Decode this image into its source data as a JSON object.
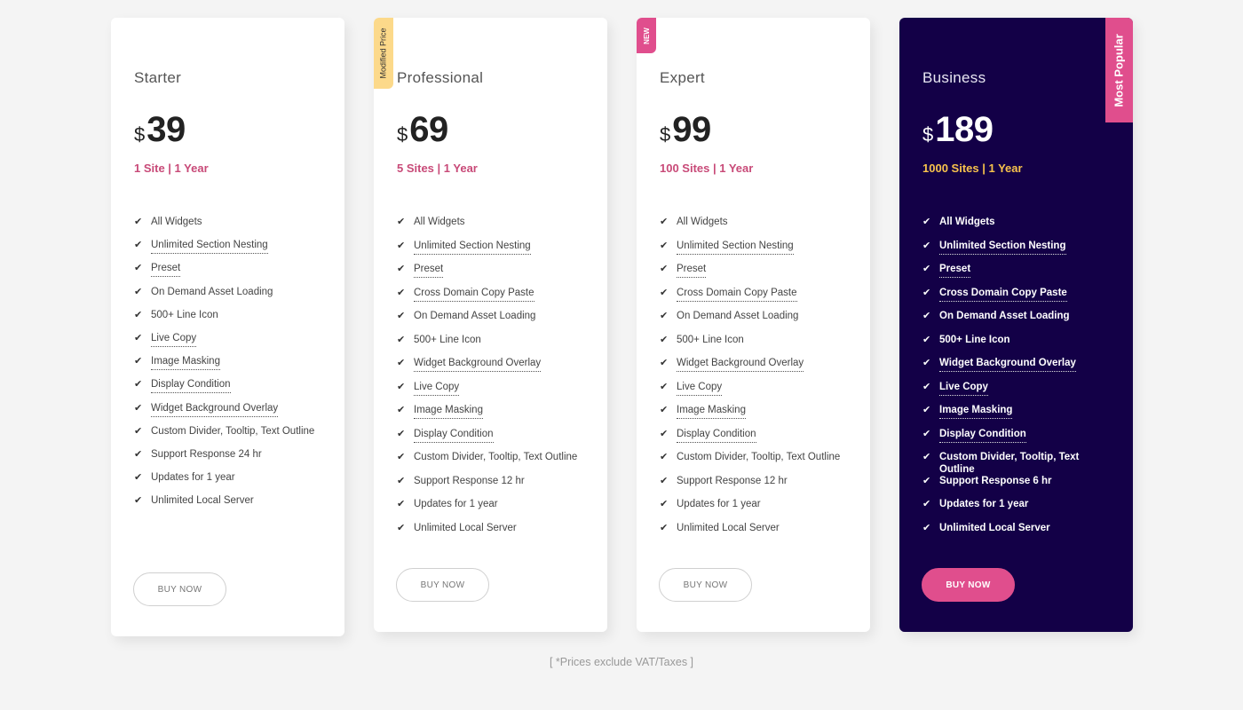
{
  "plans": [
    {
      "name": "Starter",
      "currency": "$",
      "price": "39",
      "sites": "1 Site | 1 Year",
      "button": "BUY NOW",
      "features": [
        {
          "text": "All Widgets",
          "tooltip": false
        },
        {
          "text": "Unlimited Section Nesting",
          "tooltip": true
        },
        {
          "text": "Preset",
          "tooltip": true
        },
        {
          "text": "On Demand Asset Loading",
          "tooltip": false
        },
        {
          "text": "500+ Line Icon",
          "tooltip": false
        },
        {
          "text": "Live Copy",
          "tooltip": true
        },
        {
          "text": "Image Masking",
          "tooltip": true
        },
        {
          "text": "Display Condition",
          "tooltip": true
        },
        {
          "text": "Widget Background Overlay",
          "tooltip": true
        },
        {
          "text": "Custom Divider, Tooltip, Text Outline",
          "tooltip": false
        },
        {
          "text": "Support Response 24 hr",
          "tooltip": false
        },
        {
          "text": "Updates for 1 year",
          "tooltip": false
        },
        {
          "text": "Unlimited Local Server",
          "tooltip": false
        }
      ]
    },
    {
      "name": "Professional",
      "badge": "Modified Price",
      "currency": "$",
      "price": "69",
      "sites": "5 Sites | 1 Year",
      "button": "BUY NOW",
      "features": [
        {
          "text": "All Widgets",
          "tooltip": false
        },
        {
          "text": "Unlimited Section Nesting",
          "tooltip": true
        },
        {
          "text": "Preset",
          "tooltip": true
        },
        {
          "text": "Cross Domain Copy Paste",
          "tooltip": true
        },
        {
          "text": "On Demand Asset Loading",
          "tooltip": false
        },
        {
          "text": "500+ Line Icon",
          "tooltip": false
        },
        {
          "text": "Widget Background Overlay",
          "tooltip": true
        },
        {
          "text": "Live Copy",
          "tooltip": true
        },
        {
          "text": "Image Masking",
          "tooltip": true
        },
        {
          "text": "Display Condition",
          "tooltip": true
        },
        {
          "text": "Custom Divider, Tooltip, Text Outline",
          "tooltip": false
        },
        {
          "text": "Support Response 12 hr",
          "tooltip": false
        },
        {
          "text": "Updates for 1 year",
          "tooltip": false
        },
        {
          "text": "Unlimited Local Server",
          "tooltip": false
        }
      ]
    },
    {
      "name": "Expert",
      "badge": "NEW",
      "currency": "$",
      "price": "99",
      "sites": "100 Sites | 1 Year",
      "button": "BUY NOW",
      "features": [
        {
          "text": "All Widgets",
          "tooltip": false
        },
        {
          "text": "Unlimited Section Nesting",
          "tooltip": true
        },
        {
          "text": "Preset",
          "tooltip": true
        },
        {
          "text": "Cross Domain Copy Paste",
          "tooltip": true
        },
        {
          "text": "On Demand Asset Loading",
          "tooltip": false
        },
        {
          "text": "500+ Line Icon",
          "tooltip": false
        },
        {
          "text": "Widget Background Overlay",
          "tooltip": true
        },
        {
          "text": "Live Copy",
          "tooltip": true
        },
        {
          "text": "Image Masking",
          "tooltip": true
        },
        {
          "text": "Display Condition",
          "tooltip": true
        },
        {
          "text": "Custom Divider, Tooltip, Text Outline",
          "tooltip": false
        },
        {
          "text": "Support Response 12 hr",
          "tooltip": false
        },
        {
          "text": "Updates for 1 year",
          "tooltip": false
        },
        {
          "text": "Unlimited Local Server",
          "tooltip": false
        }
      ]
    },
    {
      "name": "Business",
      "badge": "Most Popular",
      "currency": "$",
      "price": "189",
      "sites": "1000 Sites | 1 Year",
      "button": "BUY NOW",
      "features": [
        {
          "text": "All Widgets",
          "tooltip": false
        },
        {
          "text": "Unlimited Section Nesting",
          "tooltip": true
        },
        {
          "text": "Preset",
          "tooltip": true
        },
        {
          "text": "Cross Domain Copy Paste",
          "tooltip": true
        },
        {
          "text": "On Demand Asset Loading",
          "tooltip": false
        },
        {
          "text": "500+ Line Icon",
          "tooltip": false
        },
        {
          "text": "Widget Background Overlay",
          "tooltip": true
        },
        {
          "text": "Live Copy",
          "tooltip": true
        },
        {
          "text": "Image Masking",
          "tooltip": true
        },
        {
          "text": "Display Condition",
          "tooltip": true
        },
        {
          "text": "Custom Divider, Tooltip, Text Outline",
          "tooltip": false
        },
        {
          "text": "Support Response 6 hr",
          "tooltip": false
        },
        {
          "text": "Updates for 1 year",
          "tooltip": false
        },
        {
          "text": "Unlimited Local Server",
          "tooltip": false
        }
      ]
    }
  ],
  "icons": {
    "check": "✔"
  },
  "note": "[ *Prices exclude VAT/Taxes ]",
  "colors": {
    "page_bg": "#f4f4f4",
    "dark_card_bg": "#130047",
    "accent_pink": "#e04e8d",
    "sites_pink": "#c84a78",
    "sites_gold": "#f7c24c",
    "modified_badge": "#fcd98a"
  }
}
